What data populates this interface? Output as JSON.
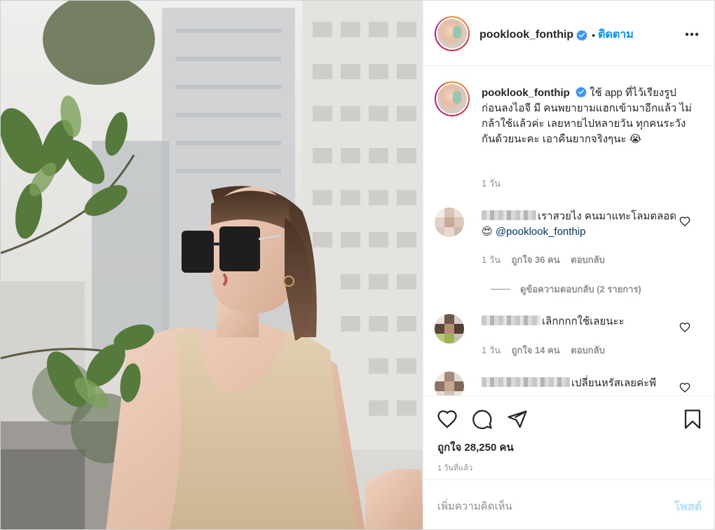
{
  "post": {
    "username": "pooklook_fonthip",
    "follow_label": "ติดตาม",
    "dot": "•"
  },
  "caption": {
    "username": "pooklook_fonthip",
    "text": "ใช้ app ที่ไว้เรียงรูป ก่อนลงไอจี มี คนพยายามแฮกเข้ามาอีกแล้ว ไม่กล้าใช้แล้วค่ะ เลยหายไปหลายวัน ทุกคนระวังกันด้วยนะคะ เอาคืนยากจริงๆนะ 😭",
    "time": "1 วัน"
  },
  "comments": [
    {
      "text": "เราสวยไง คนมาแทะโลมตลอด😍 ",
      "mention": "@pooklook_fonthip",
      "time": "1 วัน",
      "likes": "ถูกใจ 36 คน",
      "reply": "ตอบกลับ",
      "view_replies": "ดูข้อความตอบกลับ (2 รายการ)"
    },
    {
      "text": "เลิกกกกใช้เลยนะะ",
      "time": "1 วัน",
      "likes": "ถูกใจ 14 คน",
      "reply": "ตอบกลับ"
    },
    {
      "text": "เปลี่ยนหรัสเลยค่ะพี"
    }
  ],
  "actions": {
    "likes": "ถูกใจ 28,250 คน",
    "time_ago": "1 วันที่แล้ว"
  },
  "add_comment": {
    "placeholder": "เพิ่มความคิดเห็น",
    "post_label": "โพสต์"
  },
  "colors": {
    "accent": "#0095f6",
    "post_disabled": "#b2dffc",
    "muted": "#8e8e8e"
  },
  "icons": [
    "verified-badge-icon",
    "more-options-icon",
    "heart-icon",
    "comment-icon",
    "share-icon",
    "bookmark-icon"
  ]
}
